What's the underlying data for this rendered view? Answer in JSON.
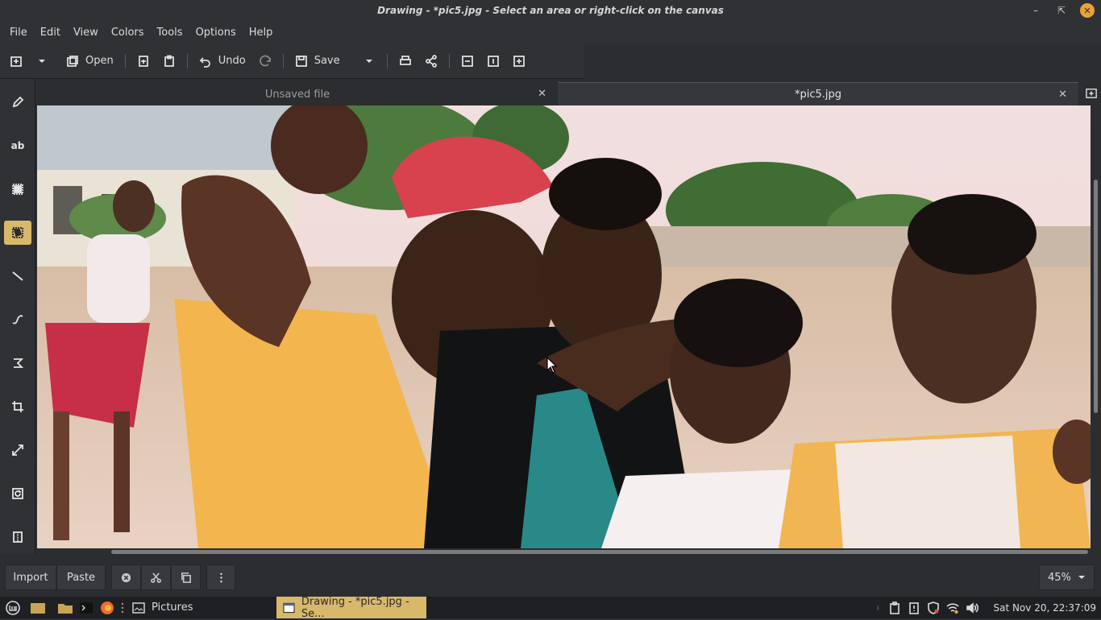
{
  "window": {
    "title": "Drawing - *pic5.jpg - Select an area or right-click on the canvas"
  },
  "menu": [
    "File",
    "Edit",
    "View",
    "Colors",
    "Tools",
    "Options",
    "Help"
  ],
  "toolbar": {
    "open_label": "Open",
    "undo_label": "Undo",
    "save_label": "Save"
  },
  "tabs": [
    {
      "label": "Unsaved file",
      "active": false
    },
    {
      "label": "*pic5.jpg",
      "active": true
    }
  ],
  "tools": [
    {
      "name": "pencil",
      "icon": "pencil-icon"
    },
    {
      "name": "text",
      "icon": "text-ab-icon",
      "label": "ab"
    },
    {
      "name": "rectangle-select",
      "icon": "rect-select-icon"
    },
    {
      "name": "free-select",
      "icon": "free-select-icon",
      "active": true
    },
    {
      "name": "line",
      "icon": "line-icon"
    },
    {
      "name": "curve",
      "icon": "curve-icon"
    },
    {
      "name": "shape",
      "icon": "shape-icon"
    },
    {
      "name": "crop",
      "icon": "crop-icon"
    },
    {
      "name": "scale",
      "icon": "scale-icon"
    },
    {
      "name": "rotate",
      "icon": "rotate-icon"
    },
    {
      "name": "filters",
      "icon": "filters-icon"
    }
  ],
  "bottom": {
    "import_label": "Import",
    "paste_label": "Paste",
    "zoom_value": "45%"
  },
  "taskbar": {
    "pictures_label": "Pictures",
    "active_task_label": "Drawing - *pic5.jpg - Se...",
    "clock": "Sat Nov 20, 22:37:09"
  },
  "colors": {
    "accent": "#d8b86a",
    "close_button": "#e8a33a",
    "panel": "#2f3134"
  }
}
